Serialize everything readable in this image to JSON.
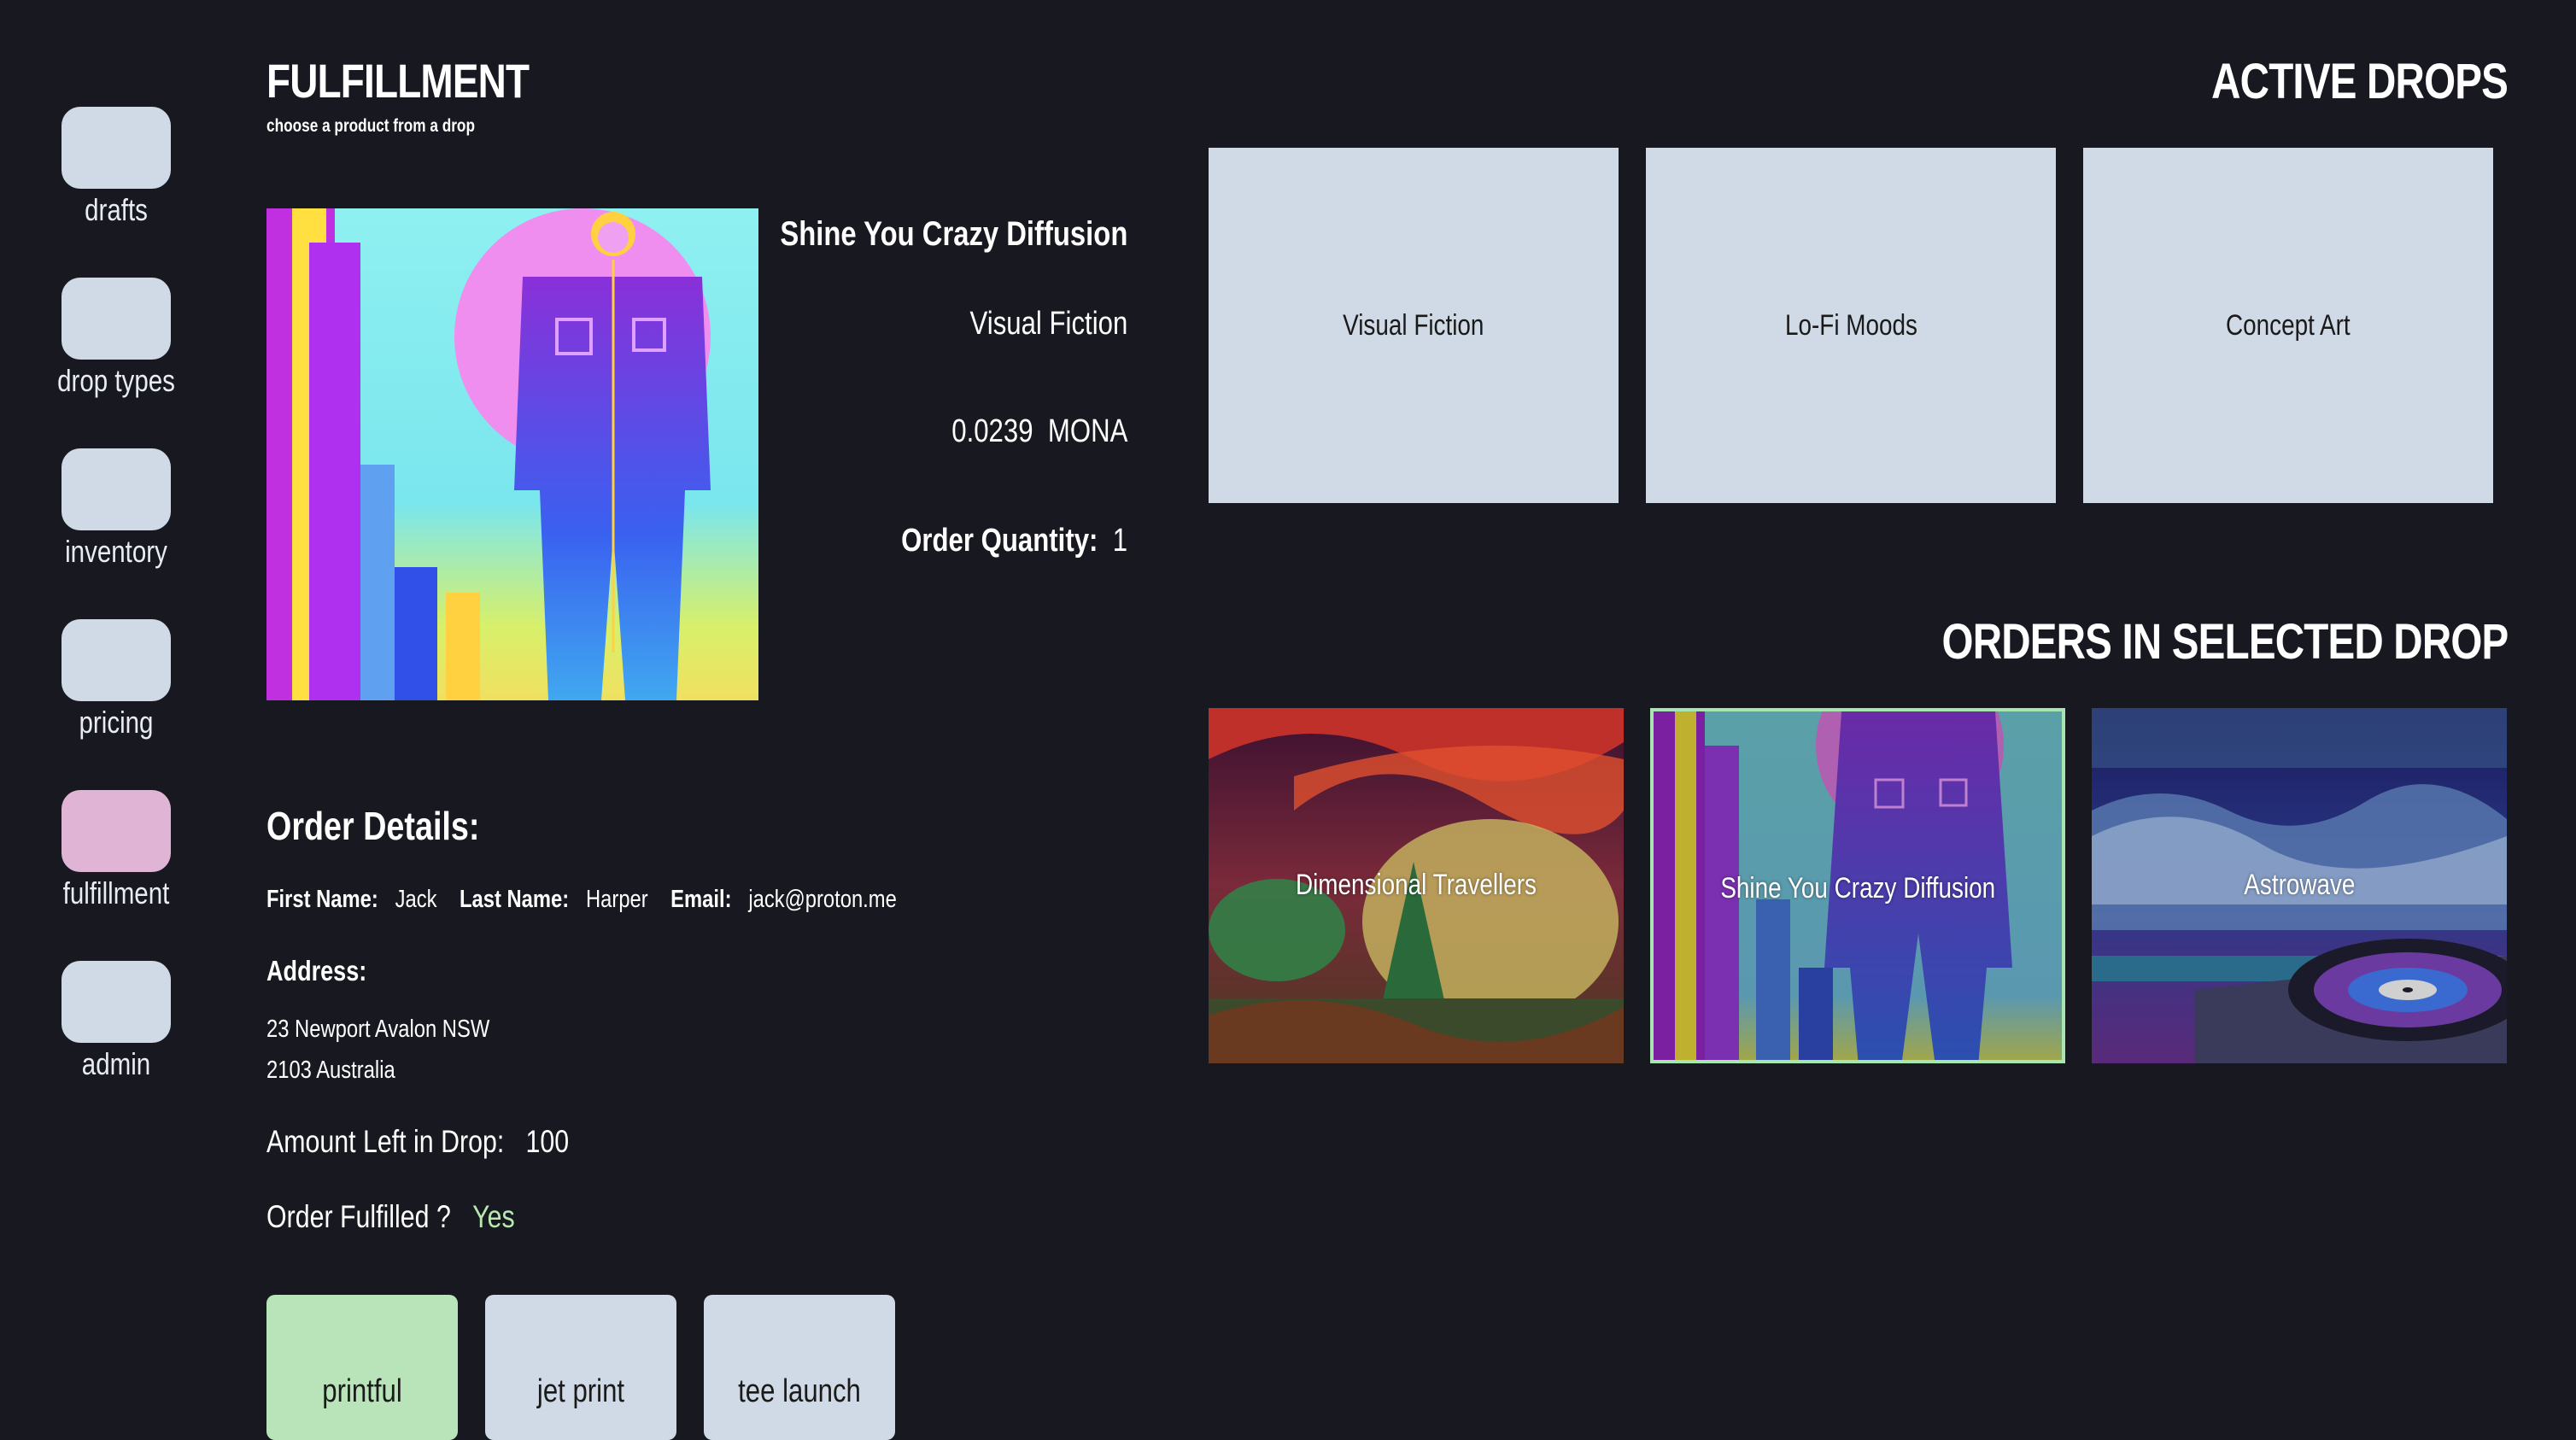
{
  "sidebar": {
    "items": [
      {
        "label": "drafts",
        "active": false
      },
      {
        "label": "drop types",
        "active": false
      },
      {
        "label": "inventory",
        "active": false
      },
      {
        "label": "pricing",
        "active": false
      },
      {
        "label": "fulfillment",
        "active": true
      },
      {
        "label": "admin",
        "active": false
      }
    ],
    "tile_color": "#cfdae6",
    "active_tile_color": "#e0b4d4"
  },
  "header": {
    "title": "FULFILLMENT",
    "subtitle": "choose a product from a drop"
  },
  "product": {
    "name": "Shine You Crazy Diffusion",
    "collection": "Visual Fiction",
    "price": "0.0239",
    "currency": "MONA",
    "order_quantity_label": "Order Quantity:",
    "order_quantity": "1"
  },
  "order_details": {
    "heading": "Order Details:",
    "first_name_label": "First Name:",
    "first_name": "Jack",
    "last_name_label": "Last Name:",
    "last_name": "Harper",
    "email_label": "Email:",
    "email": "jack@proton.me",
    "address_label": "Address:",
    "address_line1": "23 Newport Avalon NSW",
    "address_line2": "2103 Australia",
    "amount_left_label": "Amount Left in Drop:",
    "amount_left": "100",
    "fulfilled_label": "Order Fulfilled ?",
    "fulfilled_value": "Yes"
  },
  "services": [
    {
      "label": "printful",
      "color": "#b9e4b9"
    },
    {
      "label": "jet print",
      "color": "#cfdae6"
    },
    {
      "label": "tee launch",
      "color": "#cfdae6"
    }
  ],
  "active_drops": {
    "title": "ACTIVE DROPS",
    "items": [
      "Visual Fiction",
      "Lo-Fi Moods",
      "Concept Art"
    ]
  },
  "orders": {
    "title": "ORDERS IN SELECTED DROP",
    "items": [
      {
        "label": "Dimensional Travellers",
        "selected": false
      },
      {
        "label": "Shine You Crazy Diffusion",
        "selected": true
      },
      {
        "label": "Astrowave",
        "selected": false
      }
    ]
  },
  "colors": {
    "background": "#181920",
    "tile": "#cfdae6",
    "accent_green": "#a8e6b0",
    "fulfilled_text": "#b8e8b0",
    "pink_active": "#e0b4d4"
  }
}
